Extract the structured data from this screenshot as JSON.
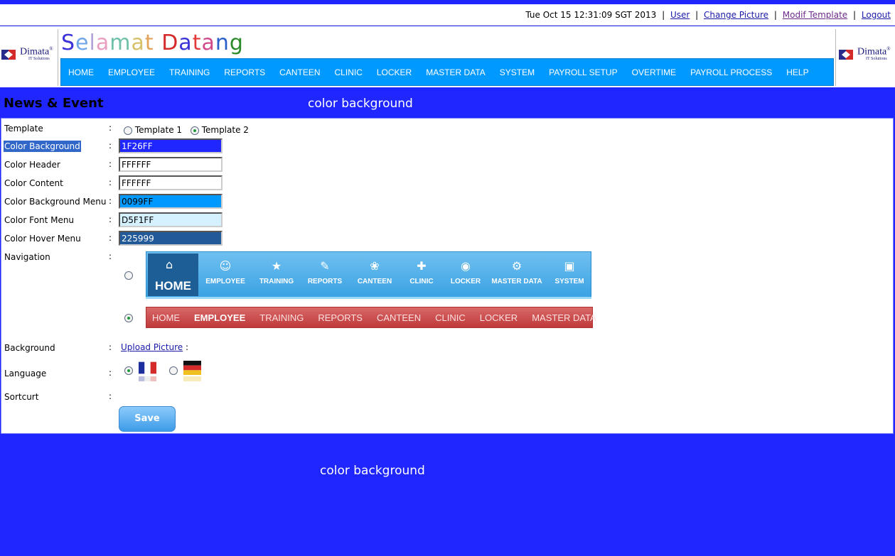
{
  "topbar": {
    "datetime": "Tue Oct 15 12:31:09 SGT 2013",
    "sep": "|",
    "links": [
      "User",
      "Change Picture",
      "Modif Template",
      "Logout"
    ]
  },
  "logo": {
    "brand": "Dimata",
    "reg": "®",
    "sub": "IT Solutions"
  },
  "welcome": {
    "letters": [
      "S",
      "e",
      "l",
      "a",
      "m",
      "a",
      "t",
      " ",
      "D",
      "a",
      "t",
      "a",
      "n",
      "g"
    ],
    "colors": [
      "#3b32d8",
      "#6fa7e8",
      "#b0a4d8",
      "#e9a0c0",
      "#6fc0a8",
      "#d7c06a",
      "#e2a35a",
      "#fff",
      "#d42a2a",
      "#3b32d8",
      "#e23a3a",
      "#d04a8a",
      "#2a5ec8",
      "#2a8a2a"
    ]
  },
  "menu": [
    "HOME",
    "EMPLOYEE",
    "TRAINING",
    "REPORTS",
    "CANTEEN",
    "CLINIC",
    "LOCKER",
    "MASTER DATA",
    "SYSTEM",
    "PAYROLL SETUP",
    "OVERTIME",
    "PAYROLL PROCESS",
    "HELP"
  ],
  "band": {
    "title": "News & Event",
    "note": "color background"
  },
  "footer_note": "color background",
  "form": {
    "colon": ":",
    "template": {
      "label": "Template",
      "options": [
        "Template 1",
        "Template 2"
      ],
      "selected": "Template 2"
    },
    "colors": [
      {
        "label": "Color Background",
        "value": "1F26FF",
        "bg": "#1F26FF",
        "fg": "#FFFFFF"
      },
      {
        "label": "Color Header",
        "value": "FFFFFF",
        "bg": "#FFFFFF",
        "fg": "#000000"
      },
      {
        "label": "Color Content",
        "value": "FFFFFF",
        "bg": "#FFFFFF",
        "fg": "#000000"
      },
      {
        "label": "Color Background Menu",
        "value": "0099FF",
        "bg": "#0099FF",
        "fg": "#000000"
      },
      {
        "label": "Color Font Menu",
        "value": "D5F1FF",
        "bg": "#D5F1FF",
        "fg": "#000000"
      },
      {
        "label": "Color Hover Menu",
        "value": "225999",
        "bg": "#225999",
        "fg": "#FFFFFF"
      }
    ],
    "navigation": {
      "label": "Navigation",
      "style1": {
        "home": "HOME",
        "items": [
          "EMPLOYEE",
          "TRAINING",
          "REPORTS",
          "CANTEEN",
          "CLINIC",
          "LOCKER",
          "MASTER DATA",
          "SYSTEM"
        ],
        "icons": [
          "users-icon",
          "training-icon",
          "reports-icon",
          "canteen-icon",
          "clinic-icon",
          "locker-icon",
          "master-data-icon",
          "system-icon"
        ]
      },
      "style2": {
        "items": [
          "HOME",
          "EMPLOYEE",
          "TRAINING",
          "REPORTS",
          "CANTEEN",
          "CLINIC",
          "LOCKER",
          "MASTER DATA"
        ],
        "active": "EMPLOYEE"
      },
      "selected": "style2"
    },
    "background": {
      "label": "Background",
      "link": "Upload Picture",
      "suffix": ":"
    },
    "language": {
      "label": "Language",
      "options": [
        "fr-flag-icon",
        "de-flag-icon"
      ],
      "selected": "fr-flag-icon"
    },
    "shortcut": {
      "label": "Sortcurt"
    },
    "save_label": "Save"
  }
}
